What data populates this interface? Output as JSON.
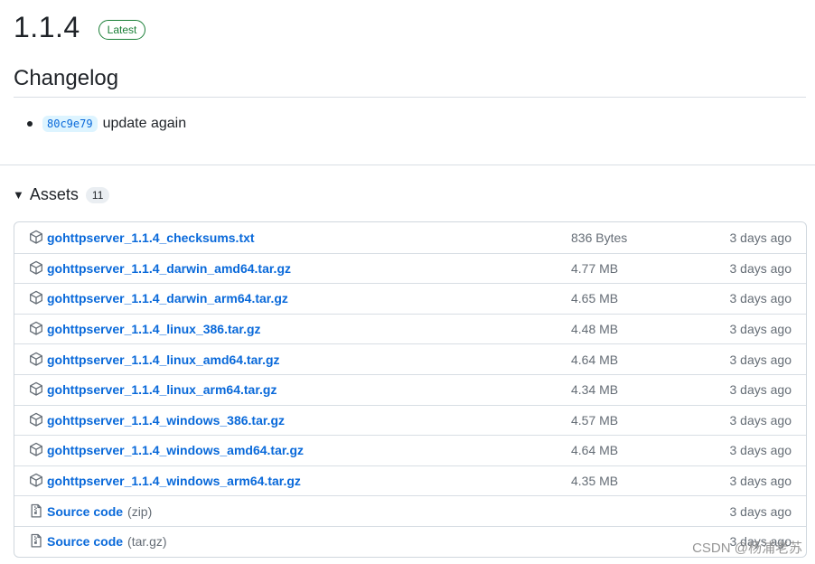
{
  "release": {
    "version": "1.1.4",
    "badge": "Latest"
  },
  "changelog": {
    "title": "Changelog",
    "items": [
      {
        "commit": "80c9e79",
        "text": "update again"
      }
    ]
  },
  "assets": {
    "title": "Assets",
    "count": "11",
    "rows": [
      {
        "name": "gohttpserver_1.1.4_checksums.txt",
        "ext": "",
        "size": "836 Bytes",
        "date": "3 days ago",
        "icon": "package-icon"
      },
      {
        "name": "gohttpserver_1.1.4_darwin_amd64.tar.gz",
        "ext": "",
        "size": "4.77 MB",
        "date": "3 days ago",
        "icon": "package-icon"
      },
      {
        "name": "gohttpserver_1.1.4_darwin_arm64.tar.gz",
        "ext": "",
        "size": "4.65 MB",
        "date": "3 days ago",
        "icon": "package-icon"
      },
      {
        "name": "gohttpserver_1.1.4_linux_386.tar.gz",
        "ext": "",
        "size": "4.48 MB",
        "date": "3 days ago",
        "icon": "package-icon"
      },
      {
        "name": "gohttpserver_1.1.4_linux_amd64.tar.gz",
        "ext": "",
        "size": "4.64 MB",
        "date": "3 days ago",
        "icon": "package-icon"
      },
      {
        "name": "gohttpserver_1.1.4_linux_arm64.tar.gz",
        "ext": "",
        "size": "4.34 MB",
        "date": "3 days ago",
        "icon": "package-icon"
      },
      {
        "name": "gohttpserver_1.1.4_windows_386.tar.gz",
        "ext": "",
        "size": "4.57 MB",
        "date": "3 days ago",
        "icon": "package-icon"
      },
      {
        "name": "gohttpserver_1.1.4_windows_amd64.tar.gz",
        "ext": "",
        "size": "4.64 MB",
        "date": "3 days ago",
        "icon": "package-icon"
      },
      {
        "name": "gohttpserver_1.1.4_windows_arm64.tar.gz",
        "ext": "",
        "size": "4.35 MB",
        "date": "3 days ago",
        "icon": "package-icon"
      },
      {
        "name": "Source code",
        "ext": "(zip)",
        "size": "",
        "date": "3 days ago",
        "icon": "file-zip-icon"
      },
      {
        "name": "Source code",
        "ext": "(tar.gz)",
        "size": "",
        "date": "3 days ago",
        "icon": "file-zip-icon"
      }
    ]
  },
  "watermark": "CSDN @杨浦老苏",
  "colors": {
    "link": "#0969da",
    "latest_badge": "#1a7f37",
    "muted": "#656d76",
    "border": "#d0d7de"
  }
}
